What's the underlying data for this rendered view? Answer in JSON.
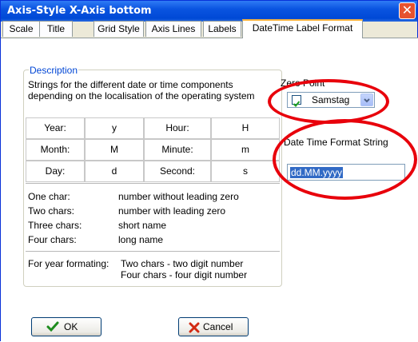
{
  "window": {
    "title": "Axis-Style X-Axis bottom",
    "close_glyph": "✕"
  },
  "tabs": [
    {
      "label": "Scale"
    },
    {
      "label": "Title"
    },
    {
      "label": "Grid Style"
    },
    {
      "label": "Axis Lines"
    },
    {
      "label": "Labels"
    },
    {
      "label": "DateTime Label Format"
    }
  ],
  "description": {
    "legend": "Description",
    "line1": "Strings for the different date or time components",
    "line2": "depending on the localisation of the operating system",
    "table": [
      [
        "Year:",
        "y",
        "Hour:",
        "H"
      ],
      [
        "Month:",
        "M",
        "Minute:",
        "m"
      ],
      [
        "Day:",
        "d",
        "Second:",
        "s"
      ]
    ],
    "rules": [
      {
        "k": "One char:",
        "v": "number without leading zero"
      },
      {
        "k": "Two chars:",
        "v": "number with leading zero"
      },
      {
        "k": "Three chars:",
        "v": "short name"
      },
      {
        "k": "Four chars:",
        "v": "long name"
      }
    ],
    "year_label": "For year formating:",
    "year_line1": "Two chars - two digit number",
    "year_line2": "Four chars - four digit number"
  },
  "zero_point": {
    "label": "Zero Point",
    "value": "Samstag",
    "checked": true
  },
  "format": {
    "label": "Date Time Format String",
    "value": "dd.MM.yyyy"
  },
  "buttons": {
    "ok": "OK",
    "cancel": "Cancel"
  },
  "colors": {
    "highlight_ring": "#e8000b",
    "title_bar": "#0a54e0"
  }
}
